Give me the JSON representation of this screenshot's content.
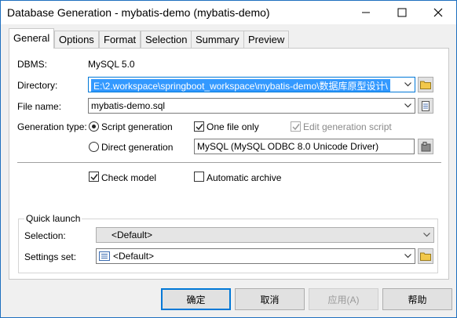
{
  "window": {
    "title": "Database Generation - mybatis-demo (mybatis-demo)"
  },
  "tabs": [
    "General",
    "Options",
    "Format",
    "Selection",
    "Summary",
    "Preview"
  ],
  "general": {
    "dbms_label": "DBMS:",
    "dbms_value": "MySQL 5.0",
    "directory_label": "Directory:",
    "directory_value": "E:\\2.workspace\\springboot_workspace\\mybatis-demo\\数据库原型设计\\",
    "filename_label": "File name:",
    "filename_value": "mybatis-demo.sql",
    "gentype_label": "Generation type:",
    "script_generation": "Script generation",
    "one_file_only": "One file only",
    "edit_generation_script": "Edit generation script",
    "direct_generation": "Direct generation",
    "direct_datasource": "MySQL (MySQL ODBC 8.0 Unicode Driver)",
    "check_model": "Check model",
    "automatic_archive": "Automatic archive"
  },
  "states": {
    "script_generation": true,
    "direct_generation": false,
    "one_file_only": true,
    "edit_generation_script": true,
    "check_model": true,
    "automatic_archive": false
  },
  "quick_launch": {
    "legend": "Quick launch",
    "selection_label": "Selection:",
    "selection_value": "<Default>",
    "settings_label": "Settings set:",
    "settings_value": "<Default>"
  },
  "buttons": {
    "ok": "确定",
    "cancel": "取消",
    "apply": "应用(A)",
    "help": "帮助"
  }
}
